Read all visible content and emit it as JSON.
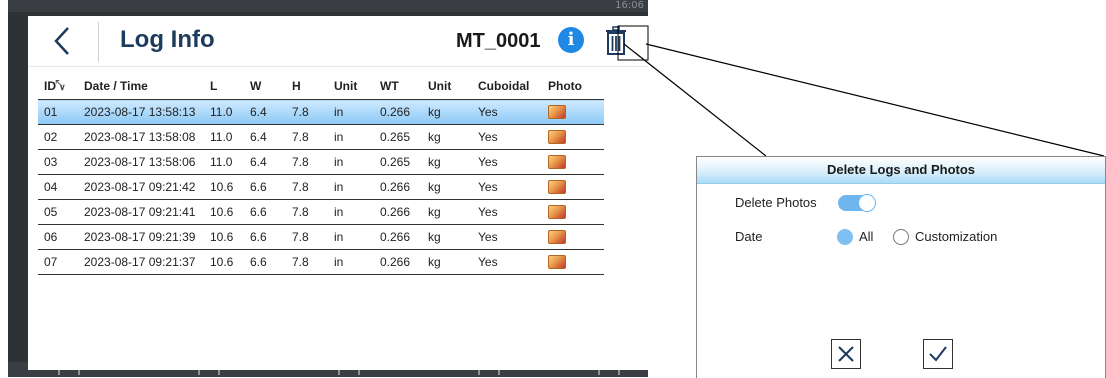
{
  "window": {
    "clock": "16:06"
  },
  "header": {
    "title": "Log Info",
    "device_id": "MT_0001",
    "info_icon": "info-icon",
    "delete_icon": "trash-icon",
    "back_icon": "back-chevron-icon"
  },
  "table": {
    "columns": [
      "ID",
      "Date / Time",
      "L",
      "W",
      "H",
      "Unit",
      "WT",
      "Unit",
      "Cuboidal",
      "Photo"
    ],
    "sort_icon": "chevron-down-icon",
    "selected_row": 0,
    "rows": [
      {
        "id": "01",
        "datetime": "2023-08-17 13:58:13",
        "l": "11.0",
        "w": "6.4",
        "h": "7.8",
        "unit": "in",
        "wt": "0.266",
        "wt_unit": "kg",
        "cuboidal": "Yes"
      },
      {
        "id": "02",
        "datetime": "2023-08-17 13:58:08",
        "l": "11.0",
        "w": "6.4",
        "h": "7.8",
        "unit": "in",
        "wt": "0.265",
        "wt_unit": "kg",
        "cuboidal": "Yes"
      },
      {
        "id": "03",
        "datetime": "2023-08-17 13:58:06",
        "l": "11.0",
        "w": "6.4",
        "h": "7.8",
        "unit": "in",
        "wt": "0.265",
        "wt_unit": "kg",
        "cuboidal": "Yes"
      },
      {
        "id": "04",
        "datetime": "2023-08-17 09:21:42",
        "l": "10.6",
        "w": "6.6",
        "h": "7.8",
        "unit": "in",
        "wt": "0.266",
        "wt_unit": "kg",
        "cuboidal": "Yes"
      },
      {
        "id": "05",
        "datetime": "2023-08-17 09:21:41",
        "l": "10.6",
        "w": "6.6",
        "h": "7.8",
        "unit": "in",
        "wt": "0.266",
        "wt_unit": "kg",
        "cuboidal": "Yes"
      },
      {
        "id": "06",
        "datetime": "2023-08-17 09:21:39",
        "l": "10.6",
        "w": "6.6",
        "h": "7.8",
        "unit": "in",
        "wt": "0.266",
        "wt_unit": "kg",
        "cuboidal": "Yes"
      },
      {
        "id": "07",
        "datetime": "2023-08-17 09:21:37",
        "l": "10.6",
        "w": "6.6",
        "h": "7.8",
        "unit": "in",
        "wt": "0.266",
        "wt_unit": "kg",
        "cuboidal": "Yes"
      }
    ]
  },
  "dialog": {
    "title": "Delete Logs and Photos",
    "delete_photos_label": "Delete Photos",
    "delete_photos_on": true,
    "date_label": "Date",
    "date_options": [
      {
        "label": "All",
        "selected": true
      },
      {
        "label": "Customization",
        "selected": false
      }
    ],
    "cancel_icon": "close-icon",
    "confirm_icon": "checkmark-icon"
  },
  "colors": {
    "accent": "#1e88e5",
    "selected_row": "#8cc9f5",
    "title": "#1d3b5c",
    "frame": "#2f3235"
  }
}
